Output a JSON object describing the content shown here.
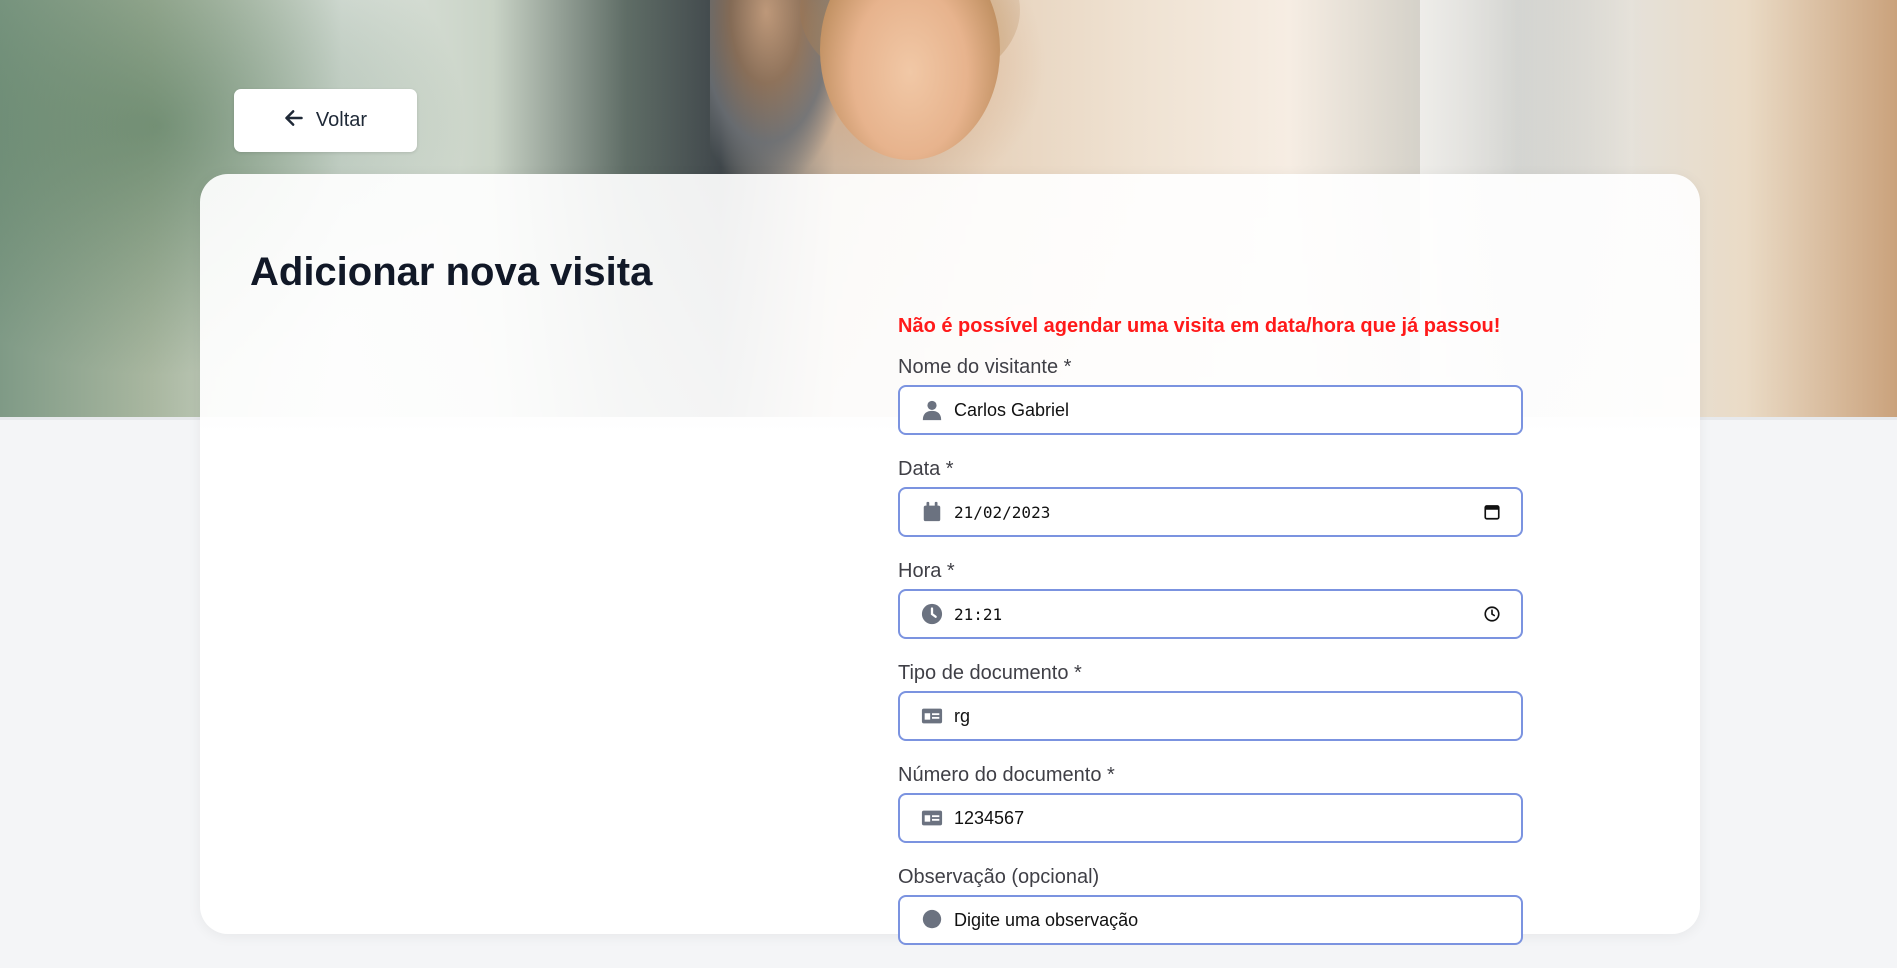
{
  "back_button": {
    "label": "Voltar",
    "icon": "arrow-left-icon"
  },
  "page": {
    "title": "Adicionar nova visita"
  },
  "form": {
    "error_message": "Não é possível agendar uma visita em data/hora que já passou!",
    "fields": [
      {
        "label": "Nome do visitante *",
        "value": "Carlos Gabriel",
        "icon": "user-icon"
      },
      {
        "label": "Data *",
        "value": "21/02/2023",
        "icon": "calendar-icon",
        "trail_icon": "calendar-picker-icon"
      },
      {
        "label": "Hora *",
        "value": "21:21",
        "icon": "clock-icon",
        "trail_icon": "time-picker-icon"
      },
      {
        "label": "Tipo de documento *",
        "value": "rg",
        "icon": "id-card-icon"
      },
      {
        "label": "Número do documento *",
        "value": "1234567",
        "icon": "id-card-icon"
      },
      {
        "label": "Observação (opcional)",
        "placeholder": "Digite uma observação",
        "icon": "comment-icon"
      }
    ]
  },
  "colors": {
    "error": "#ff1a1a",
    "input_border": "#7b93e0",
    "title": "#111827"
  }
}
